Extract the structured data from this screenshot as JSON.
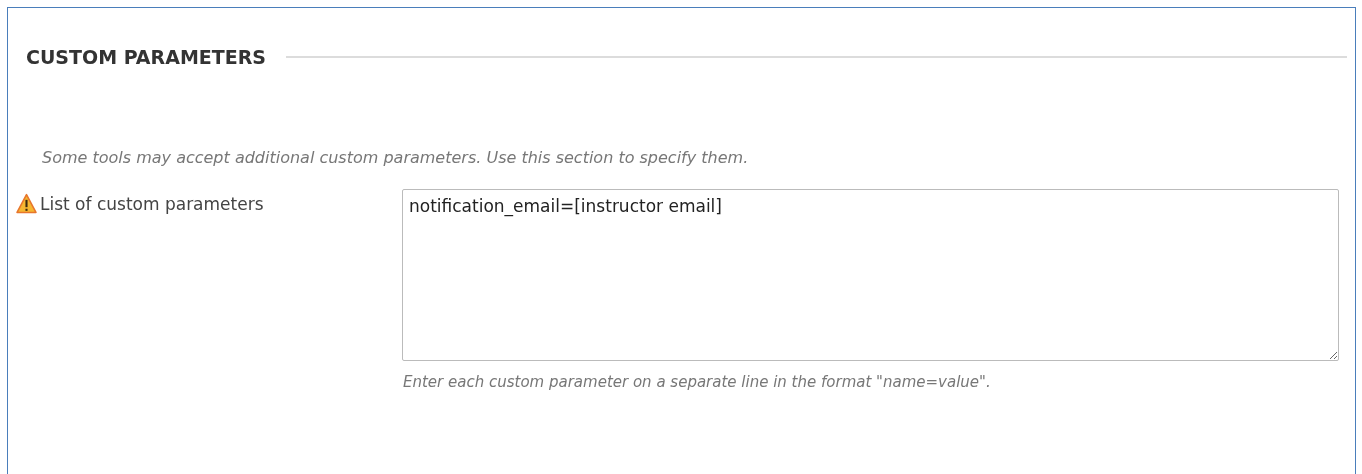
{
  "section": {
    "title": "CUSTOM PARAMETERS",
    "description": "Some tools may accept additional custom parameters. Use this section to specify them.",
    "field": {
      "label": "List of custom parameters",
      "value": "notification_email=[instructor email]",
      "hint": "Enter each custom parameter on a separate line in the format \"name=value\"."
    }
  }
}
